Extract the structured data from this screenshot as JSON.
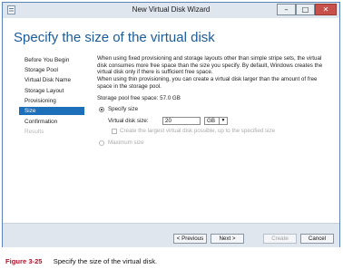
{
  "window": {
    "title": "New Virtual Disk Wizard",
    "controls": {
      "minimize": "–",
      "maximize": "□",
      "close": "✕"
    }
  },
  "page_title": "Specify the size of the virtual disk",
  "nav": {
    "items": [
      {
        "label": "Before You Begin",
        "state": "normal"
      },
      {
        "label": "Storage Pool",
        "state": "normal"
      },
      {
        "label": "Virtual Disk Name",
        "state": "normal"
      },
      {
        "label": "Storage Layout",
        "state": "normal"
      },
      {
        "label": "Provisioning",
        "state": "normal"
      },
      {
        "label": "Size",
        "state": "selected"
      },
      {
        "label": "Confirmation",
        "state": "normal"
      },
      {
        "label": "Results",
        "state": "disabled"
      }
    ]
  },
  "content": {
    "para1": "When using fixed provisioning and storage layouts other than simple stripe sets, the virtual disk consumes more free space than the size you specify. By default, Windows creates the virtual disk only if there is sufficient free space.",
    "para2": "When using thin provisioning, you can create a virtual disk larger than the amount of free space in the storage pool.",
    "free_space": "Storage pool free space:  57.0 GB",
    "specify_size_label": "Specify size",
    "specify_size_selected": true,
    "size_field_label": "Virtual disk size:",
    "size_value": "20",
    "unit_value": "GB",
    "largest_label": "Create the largest virtual disk possible, up to the specified size",
    "maximum_label": "Maximum size"
  },
  "footer": {
    "previous": "< Previous",
    "next": "Next >",
    "create": "Create",
    "cancel": "Cancel"
  },
  "caption": {
    "figure": "Figure 3-25",
    "text": "Specify the size of the virtual disk."
  },
  "colors": {
    "accent": "#1e6fba",
    "title": "#1c5b9a",
    "caption_figure": "#b5122b"
  }
}
